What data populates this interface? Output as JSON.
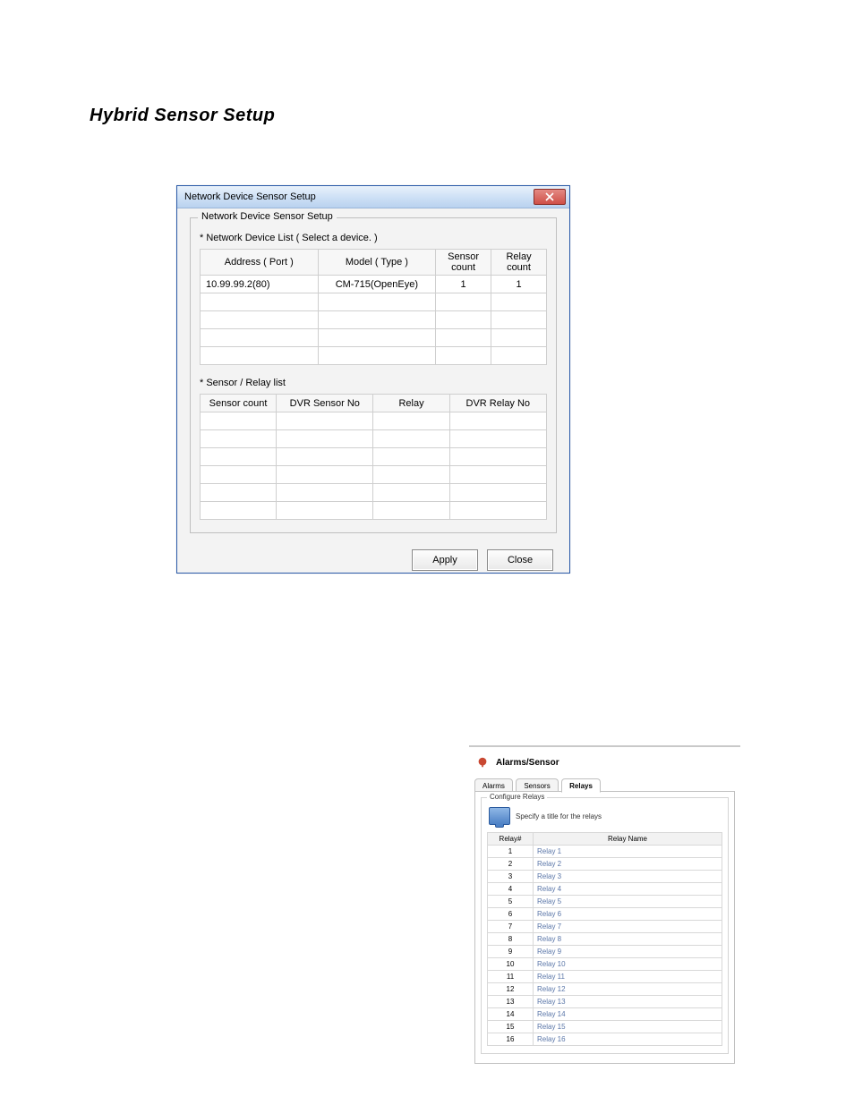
{
  "page": {
    "title": "Hybrid Sensor Setup"
  },
  "dialog1": {
    "title": "Network Device Sensor Setup",
    "group_label": "Network Device Sensor Setup",
    "device_list_label": "* Network Device List ( Select a device. )",
    "device_headers": {
      "address": "Address ( Port )",
      "model": "Model ( Type )",
      "sensor_count": "Sensor count",
      "relay_count": "Relay count"
    },
    "device_rows": [
      {
        "address": "10.99.99.2(80)",
        "model": "CM-715(OpenEye)",
        "sensor_count": "1",
        "relay_count": "1"
      }
    ],
    "sensor_list_label": "* Sensor / Relay list",
    "sensor_headers": {
      "sensor_count": "Sensor count",
      "dvr_sensor_no": "DVR Sensor No",
      "relay": "Relay",
      "dvr_relay_no": "DVR Relay No"
    },
    "buttons": {
      "apply": "Apply",
      "close": "Close"
    }
  },
  "panel2": {
    "header": "Alarms/Sensor",
    "tabs": {
      "alarms": "Alarms",
      "sensors": "Sensors",
      "relays": "Relays"
    },
    "group_label": "Configure Relays",
    "hint": "Specify a title for the relays",
    "table_headers": {
      "num": "Relay#",
      "name": "Relay Name"
    },
    "rows": [
      {
        "num": "1",
        "name": "Relay 1"
      },
      {
        "num": "2",
        "name": "Relay 2"
      },
      {
        "num": "3",
        "name": "Relay 3"
      },
      {
        "num": "4",
        "name": "Relay 4"
      },
      {
        "num": "5",
        "name": "Relay 5"
      },
      {
        "num": "6",
        "name": "Relay 6"
      },
      {
        "num": "7",
        "name": "Relay 7"
      },
      {
        "num": "8",
        "name": "Relay 8"
      },
      {
        "num": "9",
        "name": "Relay 9"
      },
      {
        "num": "10",
        "name": "Relay 10"
      },
      {
        "num": "11",
        "name": "Relay 11"
      },
      {
        "num": "12",
        "name": "Relay 12"
      },
      {
        "num": "13",
        "name": "Relay 13"
      },
      {
        "num": "14",
        "name": "Relay 14"
      },
      {
        "num": "15",
        "name": "Relay 15"
      },
      {
        "num": "16",
        "name": "Relay 16"
      }
    ]
  }
}
